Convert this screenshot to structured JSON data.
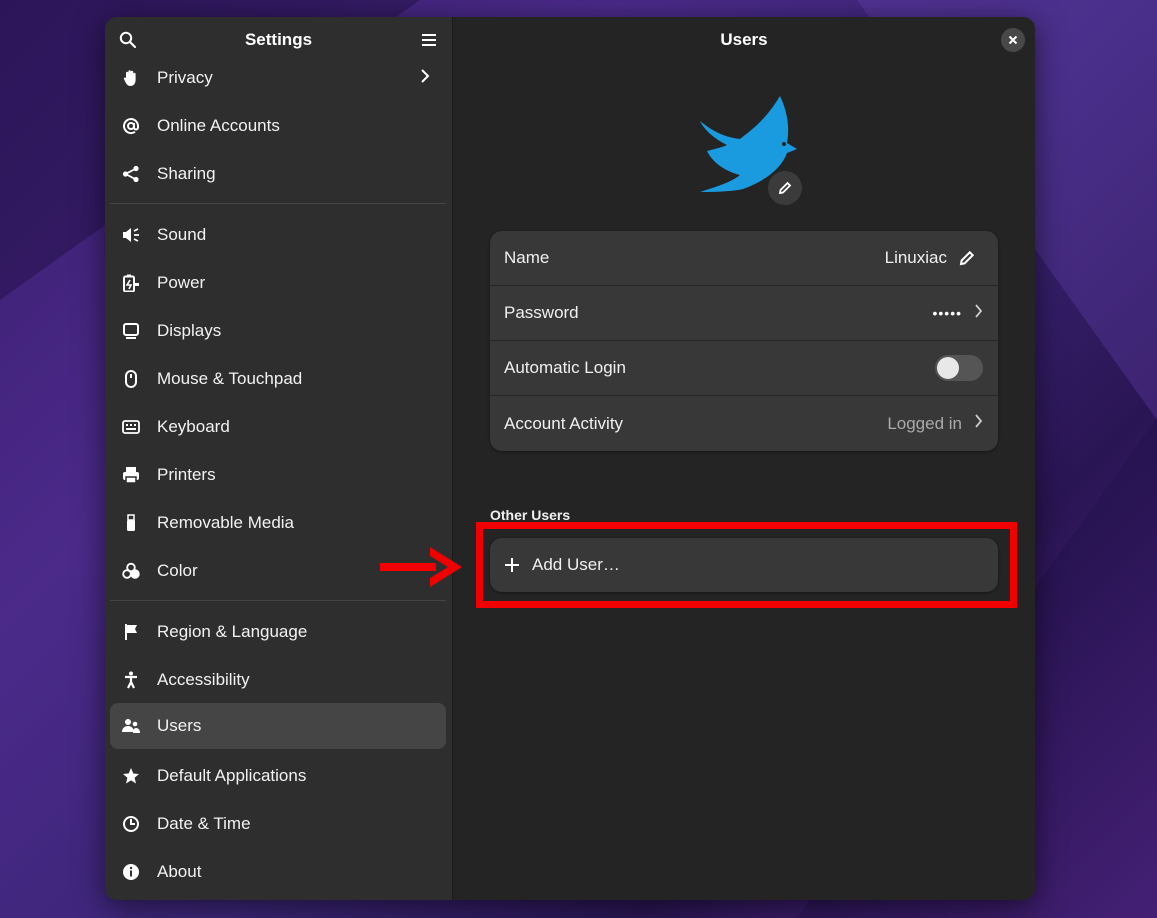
{
  "sidebar": {
    "title": "Settings",
    "items": [
      {
        "label": "Privacy",
        "icon": "hand-icon",
        "chevron": true
      },
      {
        "label": "Online Accounts",
        "icon": "at-icon"
      },
      {
        "label": "Sharing",
        "icon": "share-icon"
      },
      {
        "label": "Sound",
        "icon": "speaker-icon"
      },
      {
        "label": "Power",
        "icon": "battery-icon"
      },
      {
        "label": "Displays",
        "icon": "display-icon"
      },
      {
        "label": "Mouse & Touchpad",
        "icon": "mouse-icon"
      },
      {
        "label": "Keyboard",
        "icon": "keyboard-icon"
      },
      {
        "label": "Printers",
        "icon": "printer-icon"
      },
      {
        "label": "Removable Media",
        "icon": "usb-icon"
      },
      {
        "label": "Color",
        "icon": "color-icon"
      },
      {
        "label": "Region & Language",
        "icon": "flag-icon"
      },
      {
        "label": "Accessibility",
        "icon": "accessibility-icon"
      },
      {
        "label": "Users",
        "icon": "users-icon",
        "active": true
      },
      {
        "label": "Default Applications",
        "icon": "star-icon"
      },
      {
        "label": "Date & Time",
        "icon": "clock-icon"
      },
      {
        "label": "About",
        "icon": "info-icon"
      }
    ]
  },
  "content": {
    "title": "Users",
    "account": {
      "name_label": "Name",
      "name_value": "Linuxiac",
      "password_label": "Password",
      "password_value": "•••••",
      "autologin_label": "Automatic Login",
      "autologin_on": false,
      "activity_label": "Account Activity",
      "activity_value": "Logged in"
    },
    "other_users_title": "Other Users",
    "add_user_label": "Add User…"
  },
  "colors": {
    "highlight": "#f20000",
    "avatar_bird": "#1a9be0",
    "window_bg": "#242424",
    "sidebar_bg": "#2e2e2e"
  }
}
